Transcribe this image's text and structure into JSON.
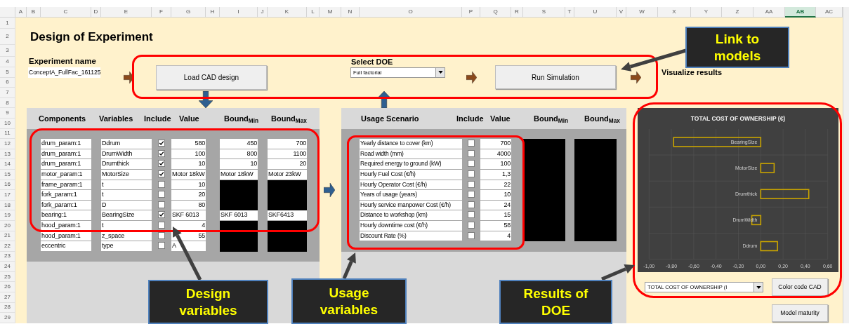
{
  "sheet": {
    "columns": [
      {
        "label": "A",
        "selected": false
      },
      {
        "label": "B",
        "selected": false
      },
      {
        "label": "C",
        "selected": false
      },
      {
        "label": "D",
        "selected": false
      },
      {
        "label": "E",
        "selected": false
      },
      {
        "label": "F",
        "selected": false
      },
      {
        "label": "G",
        "selected": false
      },
      {
        "label": "H",
        "selected": false
      },
      {
        "label": "I",
        "selected": false
      },
      {
        "label": "J",
        "selected": false
      },
      {
        "label": "K",
        "selected": false
      },
      {
        "label": "L",
        "selected": false
      },
      {
        "label": "M",
        "selected": false
      },
      {
        "label": "N",
        "selected": false
      },
      {
        "label": "O",
        "selected": false
      },
      {
        "label": "P",
        "selected": false
      },
      {
        "label": "Q",
        "selected": false
      },
      {
        "label": "R",
        "selected": false
      },
      {
        "label": "S",
        "selected": false
      },
      {
        "label": "T",
        "selected": false
      },
      {
        "label": "U",
        "selected": false
      },
      {
        "label": "V",
        "selected": false
      },
      {
        "label": "W",
        "selected": false
      },
      {
        "label": "X",
        "selected": false
      },
      {
        "label": "Y",
        "selected": false
      },
      {
        "label": "Z",
        "selected": false
      },
      {
        "label": "AA",
        "selected": false
      },
      {
        "label": "AB",
        "selected": true
      },
      {
        "label": "AC",
        "selected": false
      }
    ],
    "row_numbers": [
      "1",
      "2",
      "3",
      "4",
      "5",
      "6",
      "7",
      "8",
      "9",
      "10",
      "11",
      "12",
      "13",
      "14",
      "15",
      "16",
      "17",
      "18",
      "19",
      "20",
      "21",
      "22",
      "23",
      "24",
      "25",
      "26",
      "27",
      "28",
      "29"
    ]
  },
  "title": "Design of Experiment",
  "experiment": {
    "label": "Experiment name",
    "value": "ConceptA_FullFac_161125"
  },
  "load_button": "Load CAD design",
  "doe": {
    "label": "Select DOE",
    "value": "Full factorial"
  },
  "run_button": "Run Simulation",
  "visualize_label": "Visualize results",
  "design_table": {
    "headers": [
      "Components",
      "Variables",
      "Include",
      "Value",
      "Bound$_{Min}$",
      "Bound$_{Max}$"
    ],
    "rows": [
      {
        "component": "drum_param:1",
        "variable": "Ddrum",
        "include": true,
        "kind": "number",
        "value": "580",
        "bound_min": "450",
        "bound_max": "700"
      },
      {
        "component": "drum_param:1",
        "variable": "DrumWidth",
        "include": true,
        "kind": "number",
        "value": "100",
        "bound_min": "800",
        "bound_max": "1100"
      },
      {
        "component": "drum_param:1",
        "variable": "Drumthick",
        "include": true,
        "kind": "number",
        "value": "10",
        "bound_min": "10",
        "bound_max": "20"
      },
      {
        "component": "motor_param:1",
        "variable": "MotorSize",
        "include": true,
        "kind": "text",
        "value": "Motor 18kW",
        "bound_min": "Motor 18kW",
        "bound_max": "Motor 23kW"
      },
      {
        "component": "frame_param:1",
        "variable": "t",
        "include": false,
        "kind": "number",
        "value": "10"
      },
      {
        "component": "fork_param:1",
        "variable": "t",
        "include": false,
        "kind": "number",
        "value": "20"
      },
      {
        "component": "fork_param:1",
        "variable": "D",
        "include": false,
        "kind": "number",
        "value": "80"
      },
      {
        "component": "bearing:1",
        "variable": "BearingSize",
        "include": true,
        "kind": "text",
        "value": "SKF 6013",
        "bound_min": "SKF 6013",
        "bound_max": "SKF6413"
      },
      {
        "component": "hood_param:1",
        "variable": "t",
        "include": false,
        "kind": "number",
        "value": "4"
      },
      {
        "component": "hood_param:1",
        "variable": "z_space",
        "include": false,
        "kind": "number",
        "value": "55"
      },
      {
        "component": "eccentric",
        "variable": "type",
        "include": false,
        "kind": "text",
        "value": "A"
      }
    ]
  },
  "usage_table": {
    "headers": [
      "Usage Scenario",
      "Include",
      "Value",
      "Bound$_{Min}$",
      "Bound$_{Max}$"
    ],
    "rows": [
      {
        "label": "Yearly distance to cover (km)",
        "include": false,
        "value": "700"
      },
      {
        "label": "Road width (mm)",
        "include": false,
        "value": "4000"
      },
      {
        "label": "Required energy to ground (kW)",
        "include": false,
        "value": "100"
      },
      {
        "label": "Hourly Fuel Cost (€/h)",
        "include": false,
        "value": "1,3"
      },
      {
        "label": "Hourly Operator Cost (€/h)",
        "include": false,
        "value": "22"
      },
      {
        "label": "Years of usage (years)",
        "include": false,
        "value": "10"
      },
      {
        "label": "Hourly service manpower Cost (€/h)",
        "include": false,
        "value": "24"
      },
      {
        "label": "Distance to workshop (km)",
        "include": false,
        "value": "15"
      },
      {
        "label": "Hourly downtime cost (€/h)",
        "include": false,
        "value": "58"
      },
      {
        "label": "Discount Rate (%)",
        "include": false,
        "value": "4"
      }
    ]
  },
  "results": {
    "chart_data": {
      "type": "bar",
      "orientation": "horizontal",
      "title": "TOTAL COST OF OWNERSHIP (€)",
      "categories": [
        "BearingSize",
        "MotorSize",
        "Drumthick",
        "DrumWidth",
        "Ddrum"
      ],
      "series": [
        {
          "color": "#c9a400",
          "values": [
            -0.78,
            0.12,
            0.43,
            -0.08,
            0.15
          ]
        }
      ],
      "grid": true,
      "xlim": [
        -1,
        0.6
      ],
      "xticks": [
        {
          "value": -1,
          "label": "-1,00"
        },
        {
          "value": -0.8,
          "label": "-0,80"
        },
        {
          "value": -0.6,
          "label": "-0,60"
        },
        {
          "value": -0.4,
          "label": "-0,40"
        },
        {
          "value": -0.2,
          "label": "-0,20"
        },
        {
          "value": 0,
          "label": "0,00"
        },
        {
          "value": 0.2,
          "label": "0,20"
        },
        {
          "value": 0.4,
          "label": "0,40"
        },
        {
          "value": 0.6,
          "label": "0,60"
        }
      ]
    },
    "metric": "TOTAL COST OF OWNERSHIP (I",
    "buttons": [
      "Color code CAD",
      "Model maturity"
    ]
  },
  "callouts": [
    {
      "kind": "link",
      "text": "Link to models"
    },
    {
      "kind": "design",
      "text": "Design variables"
    },
    {
      "kind": "usage",
      "text": "Usage variables"
    },
    {
      "kind": "results",
      "text": "Results of DOE"
    }
  ]
}
